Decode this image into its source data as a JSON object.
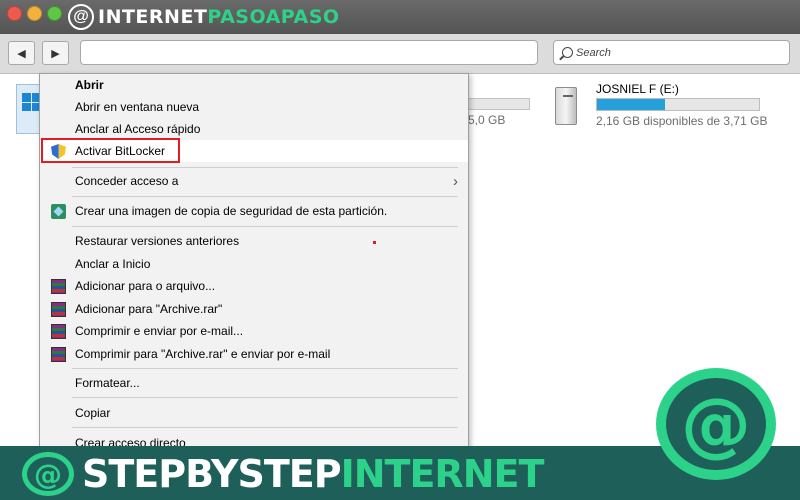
{
  "window": {
    "brand_logo_char": "@",
    "brand_prefix": "INTERNET",
    "brand_accent": "PASOAPASO",
    "search_placeholder": "Search"
  },
  "drives": {
    "c_size_text": "5,0 GB",
    "e_name": "JOSNIEL F (E:)",
    "e_free_text": "2,16 GB disponibles de 3,71 GB",
    "e_used_fraction": 0.42
  },
  "context_menu": {
    "open": "Abrir",
    "open_new_window": "Abrir en ventana nueva",
    "pin_quick_access": "Anclar al Acceso rápido",
    "bitlocker": "Activar BitLocker",
    "grant_access": "Conceder acceso a",
    "backup_image": "Crear una imagen de copia de seguridad de esta partición.",
    "restore_versions": "Restaurar versiones anteriores",
    "pin_start": "Anclar a Inicio",
    "add_archive": "Adicionar para o arquivo...",
    "add_archive_rar": "Adicionar para \"Archive.rar\"",
    "compress_email": "Comprimir e enviar por e-mail...",
    "compress_rar_email": "Comprimir para \"Archive.rar\" e enviar por e-mail",
    "format": "Formatear...",
    "copy": "Copiar",
    "create_shortcut": "Crear acceso directo"
  },
  "watermark": {
    "logo_char": "@",
    "text_prefix": "STEPBYSTEP",
    "text_accent": "INTERNET"
  },
  "colors": {
    "highlight_box": "#e31b23",
    "drive_bar_fill": "#26a0da",
    "brand_accent": "#2dd28a"
  }
}
